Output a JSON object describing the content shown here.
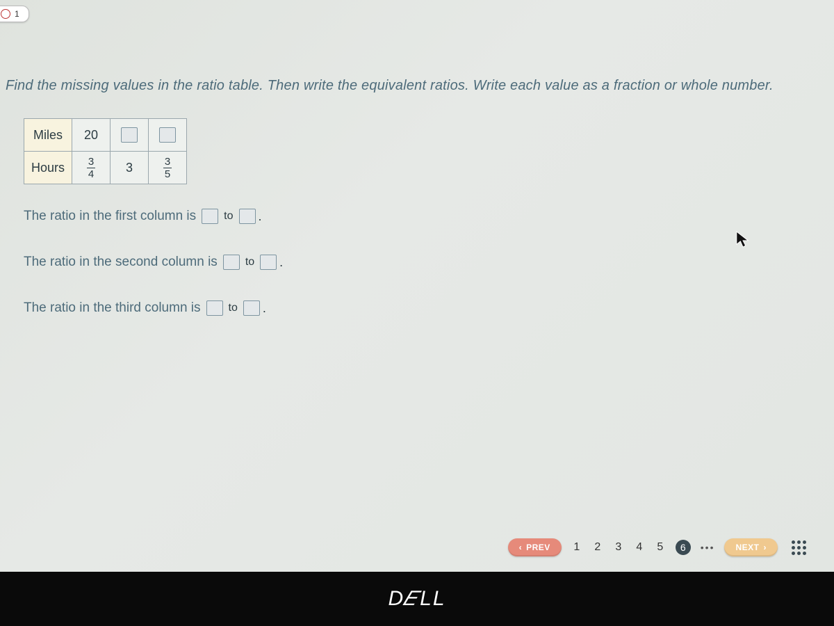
{
  "tab": {
    "number": "1"
  },
  "instructions": "Find the missing values in the ratio table. Then write the equivalent ratios. Write each value as a fraction or whole number.",
  "table": {
    "row1_label": "Miles",
    "row2_label": "Hours",
    "miles": {
      "c1": "20",
      "c2": "",
      "c3": ""
    },
    "hours": {
      "c1": {
        "num": "3",
        "den": "4"
      },
      "c2": "3",
      "c3": {
        "num": "3",
        "den": "5"
      }
    }
  },
  "sentences": {
    "s1_prefix": "The ratio in the first column is",
    "s2_prefix": "The ratio in the second column is",
    "s3_prefix": "The ratio in the third column is",
    "to": "to"
  },
  "nav": {
    "prev": "PREV",
    "next": "NEXT",
    "pages": [
      "1",
      "2",
      "3",
      "4",
      "5"
    ],
    "current": "6",
    "ellipsis": "•••"
  },
  "brand": {
    "dell": "DELL"
  }
}
